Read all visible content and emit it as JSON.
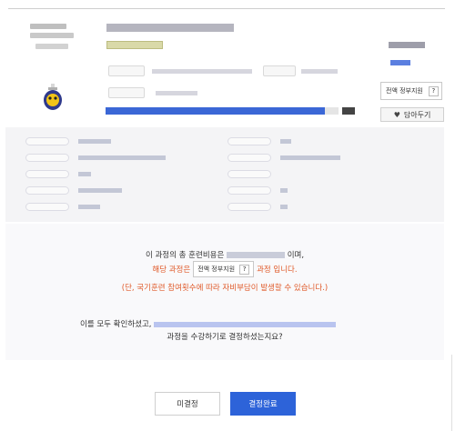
{
  "course_card": {
    "gov_support_label": "전액 정부지원",
    "help_label": "?",
    "wishlist_label": "담아두기",
    "progress_fraction": 0.94,
    "accent_color": "#3b67d6"
  },
  "confirm": {
    "line1_prefix": "이 과정의 총 훈련비용은",
    "line1_suffix": "이며,",
    "line2_prefix": "해당 과정은",
    "line2_badge": "전액 정부지원",
    "line2_help": "?",
    "line2_suffix": "과정 입니다.",
    "line3": "(단, 국기훈련 참여횟수에 따라 자비부담이 발생할 수 있습니다.)",
    "line4_prefix": "이를 모두 확인하셨고,",
    "line5": "과정을 수강하기로 결정하셨는지요?",
    "warning_color": "#e05a2a"
  },
  "buttons": {
    "cancel_label": "미결정",
    "confirm_label": "결정완료",
    "primary_color": "#2d63d9"
  },
  "icons": {
    "heart": "heart-icon",
    "help": "question-icon",
    "mascot": "mascot-icon"
  }
}
